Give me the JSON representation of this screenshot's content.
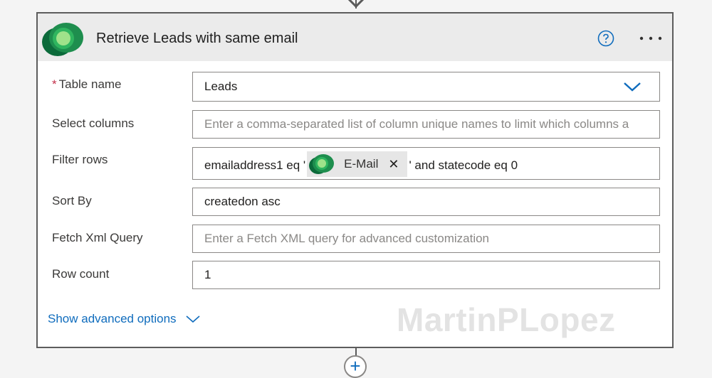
{
  "action": {
    "title": "Retrieve Leads with same email",
    "logo_icon": "dataverse-logo-icon",
    "help_icon": "help-icon",
    "more_icon": "more-options-icon"
  },
  "fields": {
    "table_name": {
      "label": "Table name",
      "required_marker": "*",
      "value": "Leads"
    },
    "select_columns": {
      "label": "Select columns",
      "placeholder": "Enter a comma-separated list of column unique names to limit which columns a"
    },
    "filter_rows": {
      "label": "Filter rows",
      "prefix": "emailaddress1 eq '",
      "token": "E-Mail",
      "suffix": "' and statecode eq 0"
    },
    "sort_by": {
      "label": "Sort By",
      "value": "createdon asc"
    },
    "fetch_xml": {
      "label": "Fetch Xml Query",
      "placeholder": "Enter a Fetch XML query for advanced customization"
    },
    "row_count": {
      "label": "Row count",
      "value": "1"
    }
  },
  "advanced_link": "Show advanced options",
  "watermark": "MartinPLopez",
  "add_step": "+",
  "colors": {
    "accent": "#0f6cbd",
    "required": "#c4314b",
    "header_bg": "#ebebeb"
  }
}
